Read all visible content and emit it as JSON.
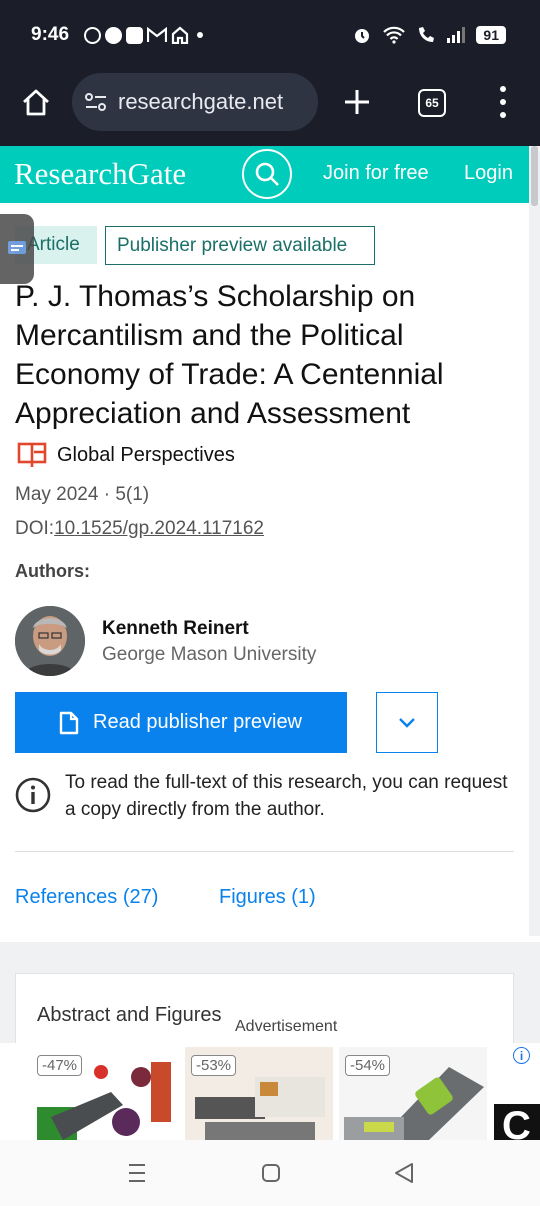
{
  "status_bar": {
    "time": "9:46",
    "battery": "91"
  },
  "browser": {
    "url": "researchgate.net",
    "tab_count": "65"
  },
  "site_header": {
    "logo": "ResearchGate",
    "join_label": "Join for free",
    "login_label": "Login"
  },
  "article": {
    "type_badge": "Article",
    "preview_badge": "Publisher preview available",
    "title": "P. J. Thomas’s Scholarship on Mercantilism and the Political Economy of Trade: A Centennial Appreciation and Assessment",
    "journal": "Global Perspectives",
    "date_issue": "May 2024 · 5(1)",
    "doi_prefix": "DOI:",
    "doi": "10.1525/gp.2024.117162",
    "authors_label": "Authors:",
    "author": {
      "name": "Kenneth Reinert",
      "institution": "George Mason University"
    },
    "read_button": "Read publisher preview",
    "info_note": "To read the full-text of this research, you can request a copy directly from the author.",
    "tabs": [
      "References (27)",
      "Figures (1)"
    ],
    "abstract_heading": "Abstract and Figures"
  },
  "ad": {
    "label": "Advertisement",
    "items": [
      {
        "discount": "-47%"
      },
      {
        "discount": "-53%"
      },
      {
        "discount": "-54%"
      }
    ],
    "info_glyph": "i",
    "partial_logo": "C"
  },
  "colors": {
    "brand": "#00ccbb",
    "accent": "#0a82ed",
    "badge_text": "#1a6f66"
  }
}
